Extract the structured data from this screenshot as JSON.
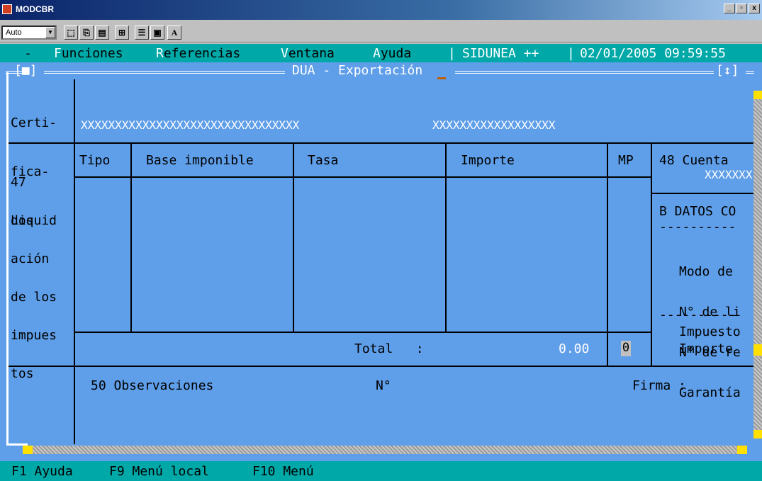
{
  "window": {
    "title": "MODCBR",
    "buttons": [
      "_",
      "▫",
      "x"
    ]
  },
  "toolbar": {
    "font_value": "Auto",
    "text_button": "A"
  },
  "menu": {
    "minus": "-",
    "funciones": {
      "hot": "F",
      "rest": "unciones"
    },
    "referencias": {
      "hot": "R",
      "rest": "eferencias"
    },
    "ventana": {
      "hot": "V",
      "rest": "entana"
    },
    "ayuda": {
      "hot": "A",
      "rest": "yuda"
    },
    "app": "SIDUNEA ++",
    "datetime": "02/01/2005 09:59:55"
  },
  "frame": {
    "title": "DUA - Exportación",
    "left_marker": "[■]",
    "right_marker": "[↕]"
  },
  "certificados": {
    "label_lines": [
      "Certi-",
      "fica-",
      "dos"
    ],
    "value1": "XXXXXXXXXXXXXXXXXXXXXXXXXXXXXXXX",
    "value2": "XXXXXXXXXXXXXXXXXX"
  },
  "liquidacion": {
    "label_lines": [
      "47",
      "Liquid",
      "ación",
      "de los",
      "impues",
      "tos"
    ],
    "headers": {
      "tipo": "Tipo",
      "base": "Base imponible",
      "tasa": "Tasa",
      "importe": "Importe",
      "mp": "MP"
    },
    "total_label": "Total   :",
    "total_value": "0.00",
    "mp_value": "0"
  },
  "right_panel": {
    "cuenta_label": "48 Cuenta",
    "cuenta_value": "XXXXXXX",
    "datos_label": "B DATOS CO",
    "dashes": "----------",
    "lines": [
      "Modo de",
      "N° de li",
      "N° de re",
      "Garantía"
    ],
    "impuesto": "Impuesto",
    "importe": "Importe"
  },
  "observaciones": {
    "label": "50 Observaciones",
    "numero": "N°",
    "firma": "Firma :"
  },
  "status": {
    "f1": "F1 Ayuda",
    "f9": "F9 Menú local",
    "f10": "F10 Menú"
  }
}
